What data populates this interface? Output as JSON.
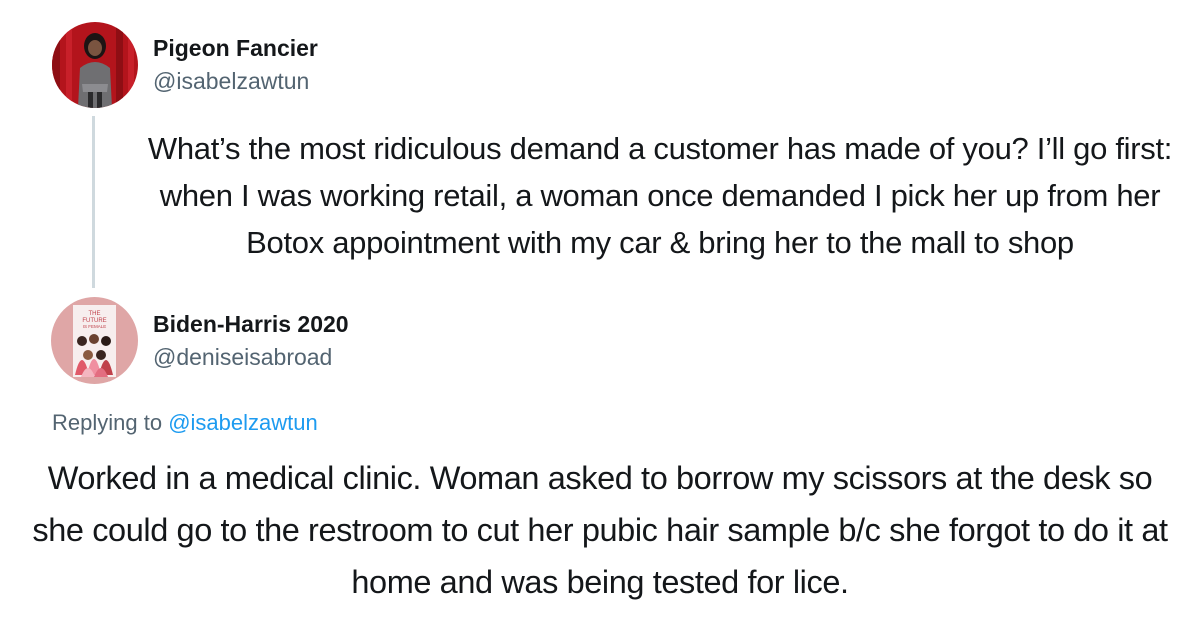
{
  "original_tweet": {
    "display_name": "Pigeon Fancier",
    "handle": "@isabelzawtun",
    "text": "What’s the most ridiculous demand a customer has made of you? I’ll go first: when I was working retail, a woman once demanded I pick her up from her Botox appointment with my car & bring her to the mall to shop"
  },
  "reply_tweet": {
    "display_name": "Biden-Harris 2020",
    "handle": "@deniseisabroad",
    "avatar_text": [
      "THE",
      "FUTURE",
      "IS FEMALE"
    ],
    "replying_prefix": "Replying to",
    "replying_mention": "@isabelzawtun",
    "text": "Worked in a medical clinic. Woman asked to borrow my scissors at the desk so she could go to the restroom to cut her pubic hair sample b/c she forgot to do it at home and was being tested for lice."
  },
  "colors": {
    "text_primary": "#14171a",
    "text_secondary": "#536471",
    "link": "#1d9bf0",
    "thread_line": "#cfd9de"
  }
}
